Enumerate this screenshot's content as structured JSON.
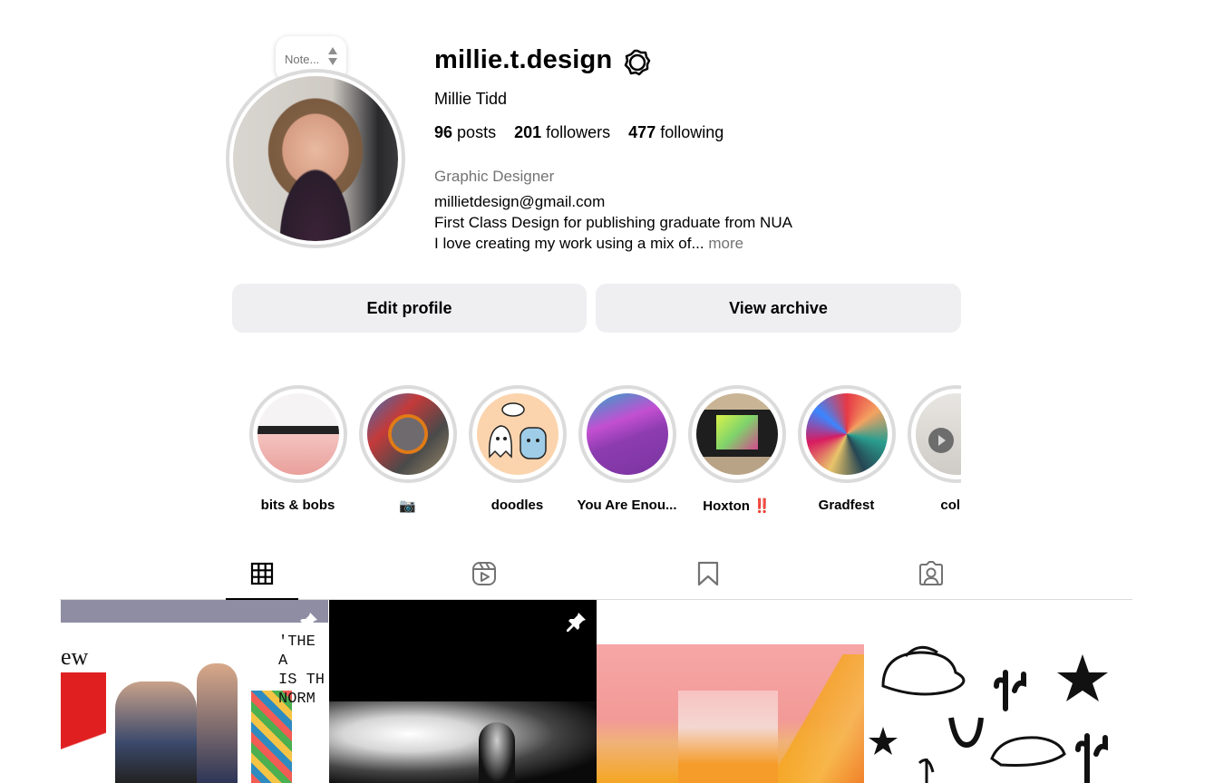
{
  "profile": {
    "note_placeholder": "Note...",
    "username": "millie.t.design",
    "full_name": "Millie Tidd",
    "stats": {
      "posts_count": "96",
      "posts_label": "posts",
      "followers_count": "201",
      "followers_label": "followers",
      "following_count": "477",
      "following_label": "following"
    },
    "category": "Graphic Designer",
    "bio_lines": [
      "millietdesign@gmail.com",
      "First Class Design for publishing graduate from NUA",
      "I love creating my work using a mix of..."
    ],
    "bio_more": "more"
  },
  "buttons": {
    "edit_profile": "Edit profile",
    "view_archive": "View archive"
  },
  "highlights": [
    {
      "label": "bits & bobs"
    },
    {
      "label": "📷"
    },
    {
      "label": "doodles"
    },
    {
      "label": "You Are Enou..."
    },
    {
      "label": "Hoxton ‼️"
    },
    {
      "label": "Gradfest"
    },
    {
      "label": "colla"
    }
  ],
  "tabs": [
    {
      "icon": "grid-icon",
      "active": true
    },
    {
      "icon": "reels-icon",
      "active": false
    },
    {
      "icon": "saved-icon",
      "active": false
    },
    {
      "icon": "tagged-icon",
      "active": false
    }
  ],
  "posts": [
    {
      "pinned": true,
      "icon": "pin-icon"
    },
    {
      "pinned": true,
      "icon": "pin-icon"
    },
    {
      "pinned": false
    },
    {
      "pinned": false
    }
  ],
  "colors": {
    "button_bg": "#efeff2",
    "muted_text": "#737373",
    "ring": "#dbdbdb"
  }
}
